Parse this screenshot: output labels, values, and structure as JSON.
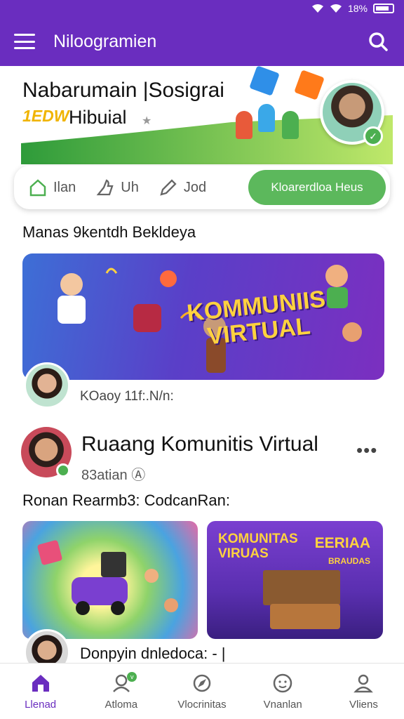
{
  "status_bar": {
    "battery_text": "18%"
  },
  "app_bar": {
    "title": "Niloogramien"
  },
  "hero": {
    "title": "Nabarumain |Sosigrai",
    "badge": "1EDW",
    "subtitle": "Hibuial"
  },
  "tabs": [
    {
      "label": "Ilan",
      "icon": "home-icon"
    },
    {
      "label": "Uh",
      "icon": "thumb-icon"
    },
    {
      "label": "Jod",
      "icon": "pencil-icon"
    }
  ],
  "active_tab": {
    "label": "Kloarerdloa Heus"
  },
  "section": {
    "title": "Manas 9kentdh Bekldeya"
  },
  "banner": {
    "title_line1": "KOMMUNIIS",
    "title_line2": "VIRTUAL",
    "caption": "KOaoy 11f:.N/n:"
  },
  "post": {
    "title": "Ruaang Komunitis Virtual",
    "meta": "83atian",
    "subtitle": "Ronan Rearmb3: CodcanRan:",
    "card_right_line1": "KOMUNITAS",
    "card_right_line2": "VIRUAS",
    "card_right_line3": "EERIAA",
    "card_right_line4": "BRAUDAS"
  },
  "footer_caption": "Donpyin dnledoca: - |",
  "bottom_nav": [
    {
      "label": "Llenad",
      "icon": "home-icon"
    },
    {
      "label": "Atloma",
      "icon": "users-icon"
    },
    {
      "label": "Vlocrinitas",
      "icon": "explore-icon"
    },
    {
      "label": "Vnanlan",
      "icon": "smile-icon"
    },
    {
      "label": "Vliens",
      "icon": "profile-icon"
    }
  ],
  "colors": {
    "primary": "#6a2dbf",
    "accent_green": "#5cb85c",
    "badge_yellow": "#f0b400"
  }
}
